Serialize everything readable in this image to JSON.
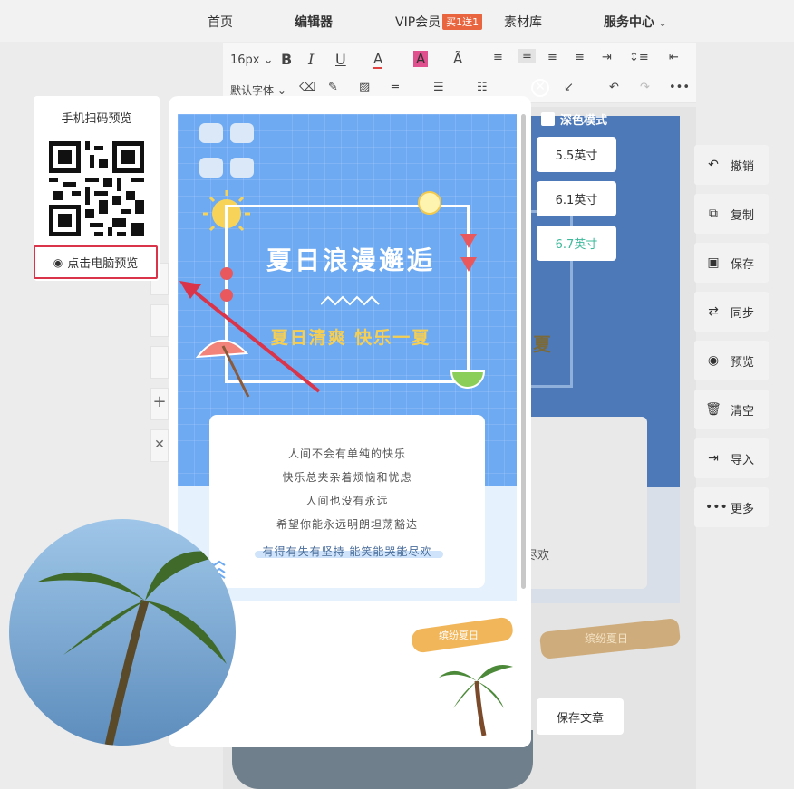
{
  "nav": {
    "home": "首页",
    "editor": "编辑器",
    "vip": "VIP会员",
    "vip_badge": "买1送1",
    "materials": "素材库",
    "service": "服务中心"
  },
  "toolbar": {
    "font_size": "16px",
    "font_family": "默认字体"
  },
  "sidebar": {
    "items": [
      {
        "label": "撤销",
        "icon": "undo-icon",
        "glyph": "↶"
      },
      {
        "label": "复制",
        "icon": "copy-icon",
        "glyph": "⧉"
      },
      {
        "label": "保存",
        "icon": "save-icon",
        "glyph": "▣"
      },
      {
        "label": "同步",
        "icon": "sync-icon",
        "glyph": "⇄"
      },
      {
        "label": "预览",
        "icon": "eye-icon",
        "glyph": "◉"
      },
      {
        "label": "清空",
        "icon": "trash-icon",
        "glyph": "🗑"
      },
      {
        "label": "导入",
        "icon": "import-icon",
        "glyph": "⇥"
      },
      {
        "label": "更多",
        "icon": "more-icon",
        "glyph": "•••"
      }
    ]
  },
  "preview": {
    "qr_title": "手机扫码预览",
    "pc_preview": "点击电脑预览",
    "dark_mode": "深色模式",
    "sizes": [
      "5.5英寸",
      "6.1英寸",
      "6.7英寸"
    ],
    "active_size": "6.7英寸",
    "save_article": "保存文章"
  },
  "poster": {
    "title": "夏日浪漫邂逅",
    "subtitle": "夏日清爽 快乐一夏",
    "poem": [
      "人间不会有单纯的快乐",
      "快乐总夹杂着烦恼和忧虑",
      "人间也没有永远",
      "希望你能永远明朗坦荡豁达"
    ],
    "poem_highlight": "有得有失有坚持 能笑能哭能尽欢",
    "brush_text": "缤纷夏日"
  },
  "background": {
    "huan": "尽欢",
    "xia": "夏",
    "brush_text": "缤纷夏日"
  },
  "colors": {
    "poster_blue": "#6eaaf2",
    "accent_green": "#3db99a",
    "highlight_red": "#d9344a"
  }
}
